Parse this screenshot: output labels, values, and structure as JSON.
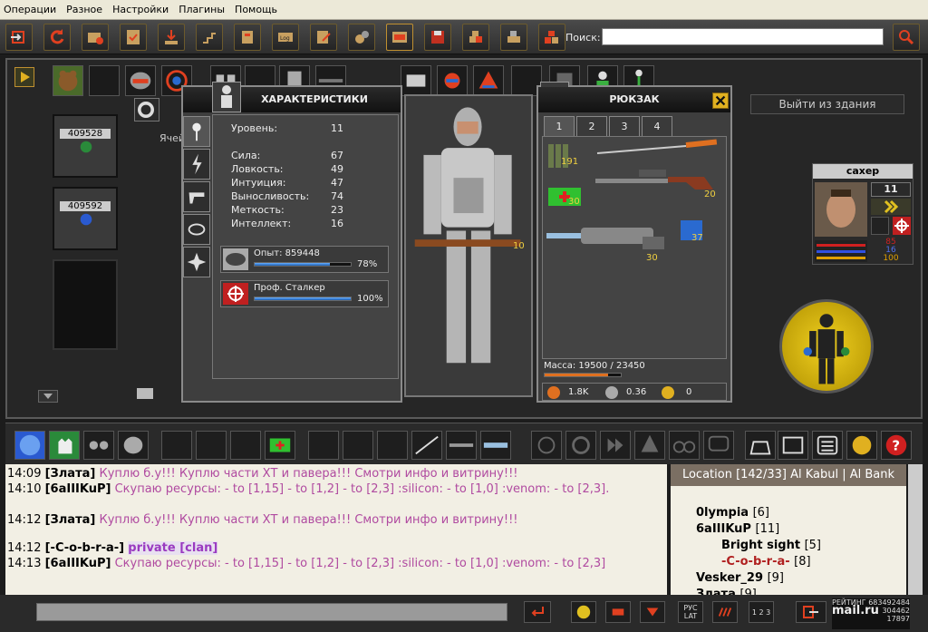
{
  "menu": [
    "Операции",
    "Разное",
    "Настройки",
    "Плагины",
    "Помощь"
  ],
  "search": {
    "label": "Поиск:",
    "placeholder": ""
  },
  "building": {
    "exit_button": "Выйти из здания",
    "cell_label": "Ячей"
  },
  "storage": [
    {
      "id": "409528"
    },
    {
      "id": "409592"
    }
  ],
  "stats_panel": {
    "title": "ХАРАКТЕРИСТИКИ",
    "level_label": "Уровень:",
    "level_value": "11",
    "stats": [
      {
        "label": "Сила:",
        "value": "67"
      },
      {
        "label": "Ловкость:",
        "value": "49"
      },
      {
        "label": "Интуиция:",
        "value": "47"
      },
      {
        "label": "Выносливость:",
        "value": "74"
      },
      {
        "label": "Меткость:",
        "value": "23"
      },
      {
        "label": "Интеллект:",
        "value": "16"
      }
    ],
    "experience": {
      "label": "Опыт: 859448",
      "percent_text": "78%",
      "fraction": 0.78
    },
    "profession": {
      "label": "Проф. Сталкер",
      "percent_text": "100%",
      "fraction": 1.0
    }
  },
  "backpack": {
    "title": "РЮКЗАК",
    "tabs": [
      "1",
      "2",
      "3",
      "4"
    ],
    "items": [
      {
        "name": "ammo-icon",
        "count": "191"
      },
      {
        "name": "katana-icon",
        "count": ""
      },
      {
        "name": "sniper-rifle-icon",
        "count": "20"
      },
      {
        "name": "medkit-icon",
        "count": "30"
      },
      {
        "name": "plasma-rifle-icon",
        "count": "30"
      },
      {
        "name": "battery-icon",
        "count": "37"
      }
    ],
    "mass": "Масса: 19500 / 23450",
    "mass_fraction": 0.83,
    "currency": [
      {
        "icon": "gold-coin-icon",
        "value": "1.8K"
      },
      {
        "icon": "silver-coin-icon",
        "value": "0.36"
      },
      {
        "icon": "z-coin-icon",
        "value": "0"
      }
    ]
  },
  "character": {
    "equipped_weapon_count": "10"
  },
  "target": {
    "name": "сахер",
    "level": "11",
    "hp": "85",
    "mp": "16",
    "sp": "100",
    "colors": {
      "hp": "#d02020",
      "mp": "#3050e0",
      "sp": "#e0a000"
    }
  },
  "chat": [
    {
      "time": "14:09",
      "nick": "[Злата]",
      "text": "Куплю б.у!!!    Куплю части ХТ и павера!!! Смотри инфо и витрину!!!",
      "color": "#b04aa0"
    },
    {
      "time": "14:10",
      "nick": "[6aIIIKuP]",
      "text": "Скупаю ресурсы:  - to [1,15]  - to [1,2]  - to [2,3] :silicon: - to [1,0] :venom: - to [2,3].",
      "color": "#b04aa0"
    },
    {
      "time": "14:12",
      "nick": "[Злата]",
      "text": "Куплю б.у!!!    Куплю части ХТ и павера!!! Смотри инфо и витрину!!!",
      "color": "#b04aa0"
    },
    {
      "time": "14:12",
      "nick": "[-C-o-b-r-a-]",
      "text": "private [clan]",
      "color": "#9a3ac0"
    },
    {
      "time": "14:13",
      "nick": "[6aIIIKuP]",
      "text": "Скупаю ресурсы:  - to [1,15]  - to [1,2]  - to [2,3] :silicon: - to [1,0] :venom: - to [2,3]",
      "color": "#b04aa0"
    }
  ],
  "online": {
    "location": "Location [142/33] Al Kabul | Al Bank",
    "users": [
      {
        "name": "0lympia",
        "level": "[6]"
      },
      {
        "name": "6aIIIKuP",
        "level": "[11]"
      },
      {
        "name": "Bright sight",
        "level": "[5]"
      },
      {
        "name": "-C-o-b-r-a-",
        "level": "[8]"
      },
      {
        "name": "Vesker_29",
        "level": "[9]"
      },
      {
        "name": "Злата",
        "level": "[9]"
      }
    ]
  },
  "input_bar": {
    "layout_button": "РУС LAT",
    "numbers_button": "1 2 3"
  },
  "rating": {
    "label": "РЕЙТИНГ",
    "value": "683492484",
    "v2": "304462",
    "v3": "17897",
    "brand": "mail.ru"
  }
}
